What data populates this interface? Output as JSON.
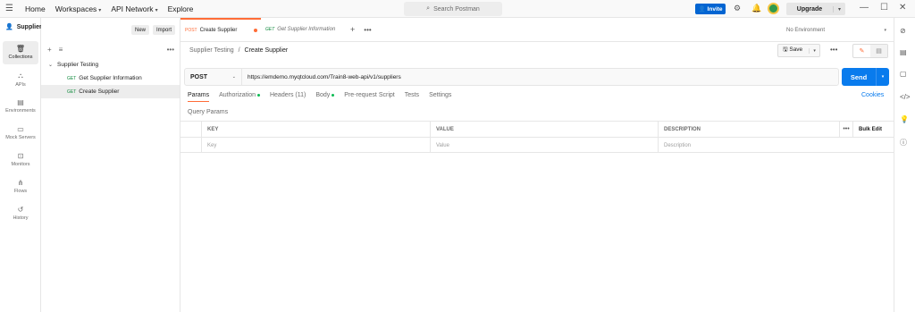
{
  "topbar": {
    "menu_icon": "hamburger-icon",
    "nav": [
      "Home",
      "Workspaces",
      "API Network",
      "Explore"
    ],
    "search_placeholder": "Search Postman",
    "invite_label": "Invite",
    "upgrade_label": "Upgrade"
  },
  "workspace": {
    "name": "Supplier Testing",
    "new_label": "New",
    "import_label": "Import"
  },
  "rail": [
    {
      "label": "Collections",
      "icon": "collections-icon"
    },
    {
      "label": "APIs",
      "icon": "apis-icon"
    },
    {
      "label": "Environments",
      "icon": "environments-icon"
    },
    {
      "label": "Mock Servers",
      "icon": "mock-servers-icon"
    },
    {
      "label": "Monitors",
      "icon": "monitors-icon"
    },
    {
      "label": "Flows",
      "icon": "flows-icon"
    },
    {
      "label": "History",
      "icon": "history-icon"
    }
  ],
  "tree": {
    "collection": "Supplier Testing",
    "items": [
      {
        "method": "GET",
        "name": "Get Supplier Information"
      },
      {
        "method": "GET",
        "name": "Create Supplier"
      }
    ]
  },
  "tabs": [
    {
      "method": "POST",
      "name": "Create Supplier"
    },
    {
      "method": "GET",
      "name": "Get Supplier Information"
    }
  ],
  "environment": "No Environment",
  "breadcrumb": {
    "parent": "Supplier Testing",
    "sep": "/",
    "current": "Create Supplier"
  },
  "save_label": "Save",
  "request": {
    "method": "POST",
    "url": "https://emdemo.myqtcloud.com/Train8-web-api/v1/suppliers",
    "send_label": "Send"
  },
  "request_tabs": [
    "Params",
    "Authorization",
    "Headers (11)",
    "Body",
    "Pre-request Script",
    "Tests",
    "Settings"
  ],
  "cookies_label": "Cookies",
  "query_params": {
    "title": "Query Params",
    "headers": [
      "KEY",
      "VALUE",
      "DESCRIPTION"
    ],
    "bulk_edit": "Bulk Edit",
    "placeholders": [
      "Key",
      "Value",
      "Description"
    ]
  },
  "colors": {
    "accent": "#ff6c37",
    "send": "#097bed",
    "invite": "#0265d2",
    "get_method": "#0f8a3c"
  }
}
